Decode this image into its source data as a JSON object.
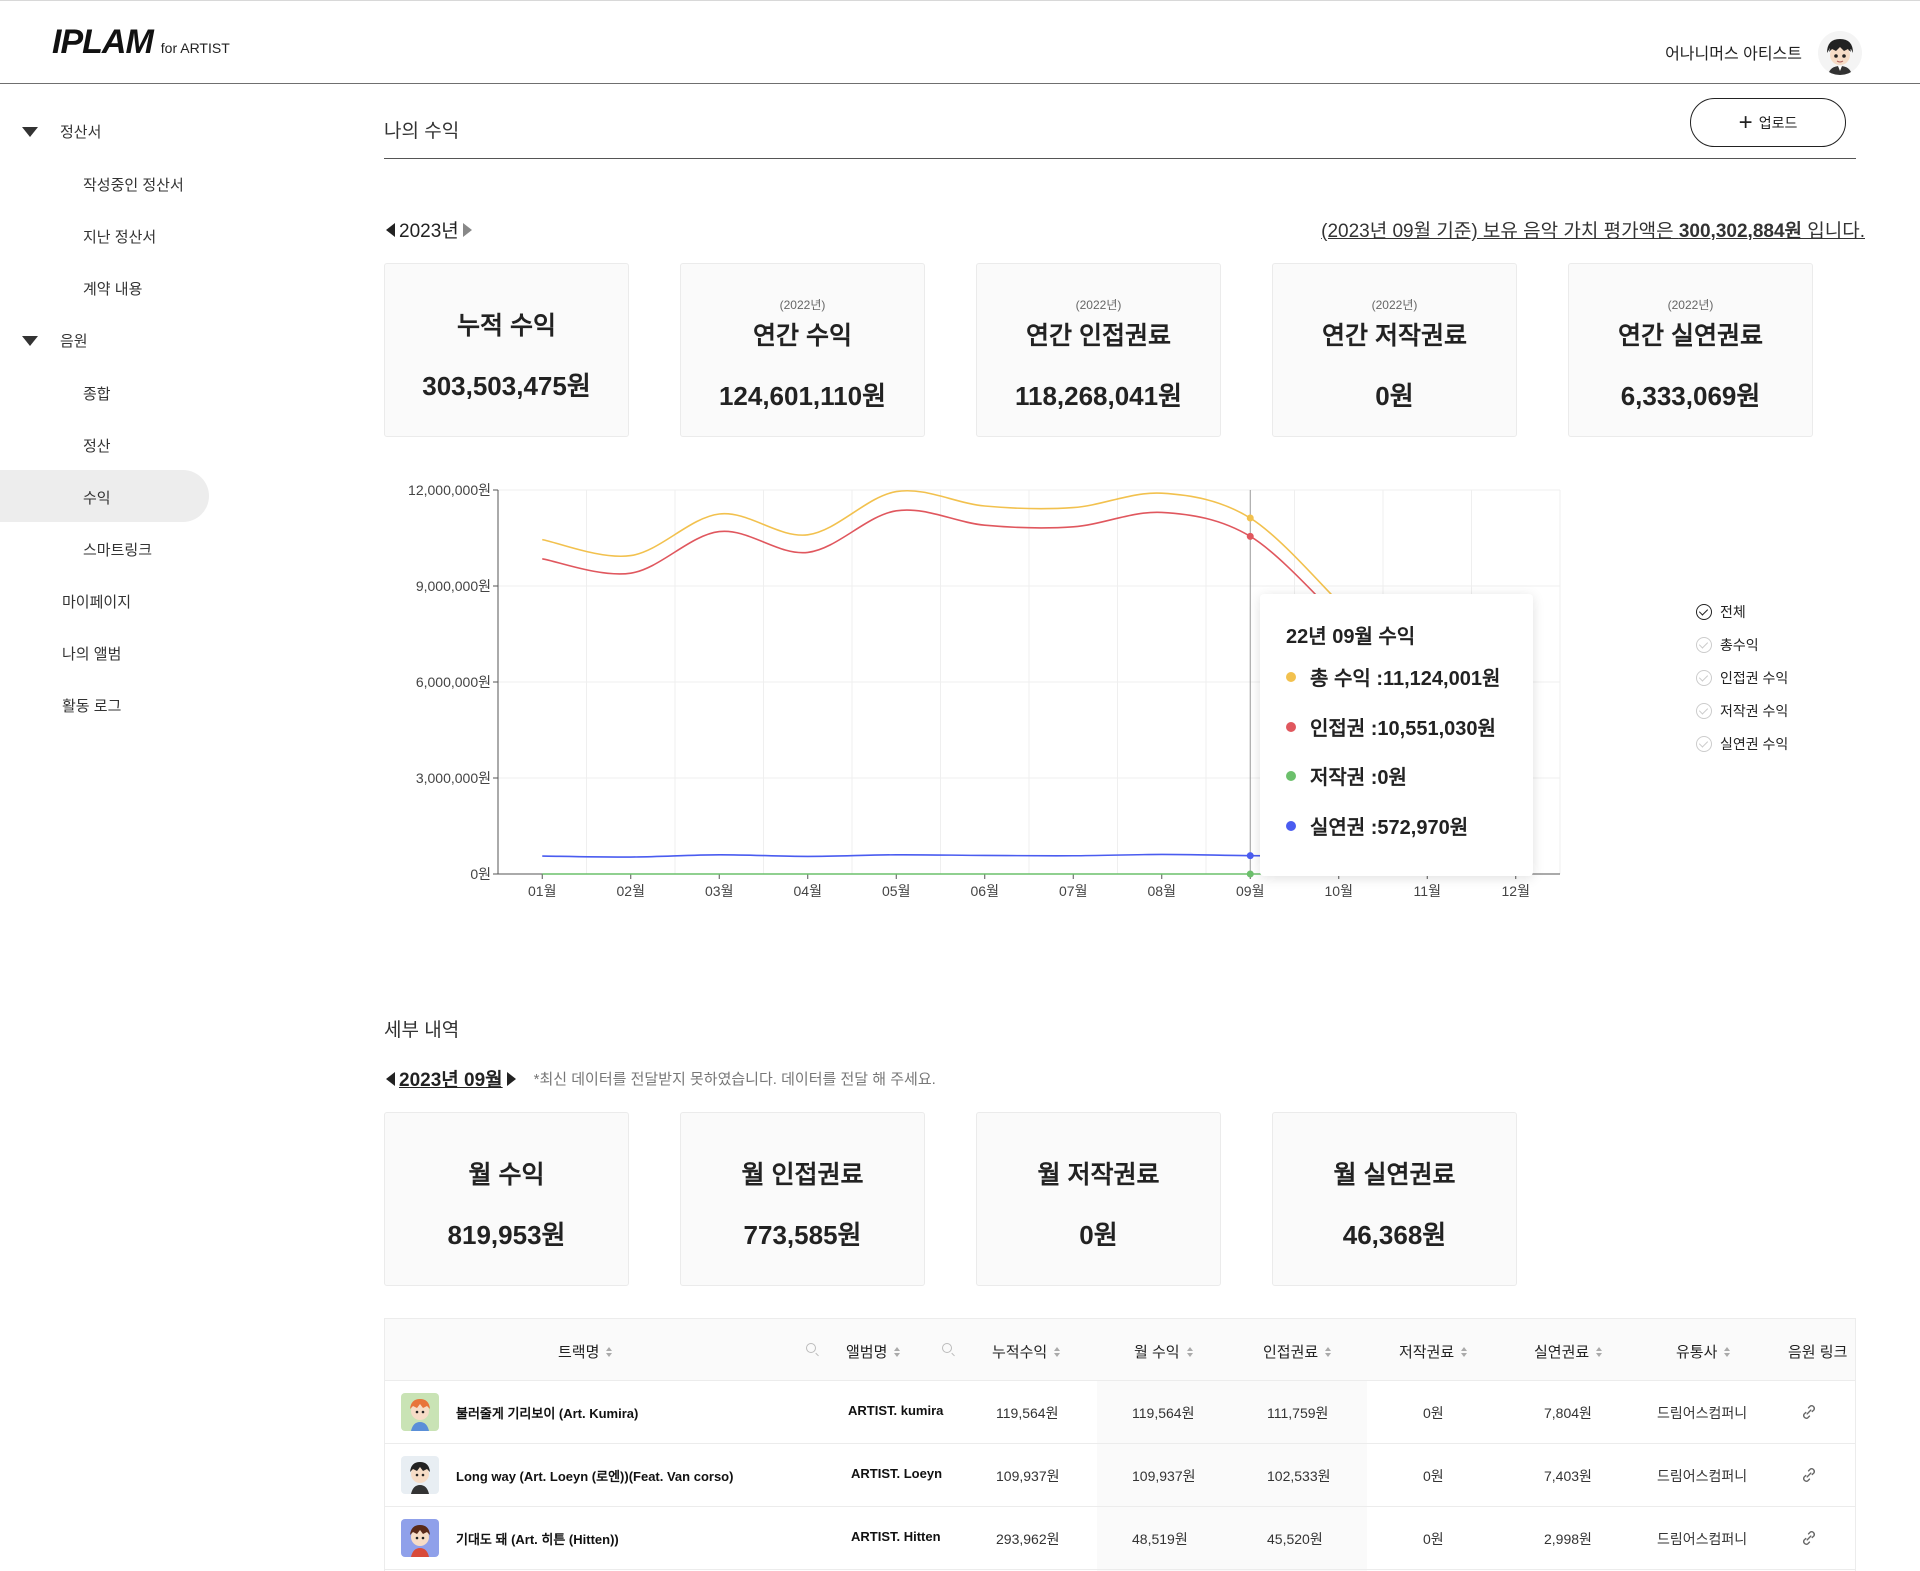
{
  "header": {
    "logo_main": "IPLAM",
    "logo_sub": "for ARTIST",
    "user_name": "어나니머스 아티스트"
  },
  "sidebar": {
    "groups": [
      {
        "label": "정산서",
        "items": [
          "작성중인 정산서",
          "지난 정산서",
          "계약 내용"
        ]
      },
      {
        "label": "음원",
        "items": [
          "종합",
          "정산",
          "수익",
          "스마트링크"
        ]
      }
    ],
    "top_items": [
      "마이페이지",
      "나의 앨범",
      "활동 로그"
    ],
    "active_item": "수익"
  },
  "page": {
    "title": "나의 수익",
    "upload_label": "업로드"
  },
  "year_selector": {
    "year": "2023년"
  },
  "valuation": {
    "prefix": "(2023년 09월 기준) 보유 음악 가치 평가액은 ",
    "amount": "300,302,884원",
    "suffix": " 입니다."
  },
  "annual_cards": [
    {
      "sub": "",
      "label": "누적 수익",
      "value": "303,503,475원"
    },
    {
      "sub": "(2022년)",
      "label": "연간 수익",
      "value": "124,601,110원"
    },
    {
      "sub": "(2022년)",
      "label": "연간 인접권료",
      "value": "118,268,041원"
    },
    {
      "sub": "(2022년)",
      "label": "연간 저작권료",
      "value": "0원"
    },
    {
      "sub": "(2022년)",
      "label": "연간 실연권료",
      "value": "6,333,069원"
    }
  ],
  "chart_data": {
    "type": "line",
    "categories": [
      "01월",
      "02월",
      "03월",
      "04월",
      "05월",
      "06월",
      "07월",
      "08월",
      "09월",
      "10월",
      "11월",
      "12월"
    ],
    "y_ticks": [
      "0원",
      "3,000,000원",
      "6,000,000원",
      "9,000,000원",
      "12,000,000원"
    ],
    "ylim": [
      0,
      12000000
    ],
    "grid": true,
    "legend_position": "right",
    "series": [
      {
        "key": "total",
        "color": "#f2c14e",
        "values": [
          10450000,
          9950000,
          11250000,
          10600000,
          11950000,
          11500000,
          11450000,
          11900000,
          11124001,
          8500000,
          null,
          null
        ]
      },
      {
        "key": "neighbor",
        "color": "#e0575e",
        "values": [
          9850000,
          9400000,
          10700000,
          10050000,
          11350000,
          10900000,
          10850000,
          11300000,
          10551030,
          8000000,
          null,
          null
        ]
      },
      {
        "key": "copyright",
        "color": "#6cc06c",
        "values": [
          0,
          0,
          0,
          0,
          0,
          0,
          0,
          0,
          0,
          0,
          null,
          null
        ]
      },
      {
        "key": "performance",
        "color": "#4a5cf0",
        "values": [
          560000,
          530000,
          600000,
          550000,
          600000,
          580000,
          570000,
          610000,
          572970,
          560000,
          null,
          null
        ]
      }
    ],
    "tooltip": {
      "title": "22년 09월 수익",
      "index": 8,
      "rows": [
        {
          "text": "총 수익 :11,124,001원",
          "color": "#f2c14e"
        },
        {
          "text": "인접권 :10,551,030원",
          "color": "#e0575e"
        },
        {
          "text": "저작권 :0원",
          "color": "#6cc06c"
        },
        {
          "text": "실연권 :572,970원",
          "color": "#4a5cf0"
        }
      ]
    },
    "legend": [
      {
        "label": "전체",
        "checked": true
      },
      {
        "label": "총수익",
        "checked": false
      },
      {
        "label": "인접권 수익",
        "checked": false
      },
      {
        "label": "저작권 수익",
        "checked": false
      },
      {
        "label": "실연권 수익",
        "checked": false
      }
    ]
  },
  "detail": {
    "title": "세부 내역",
    "month": "2023년 09월",
    "note": "*최신 데이터를 전달받지 못하였습니다. 데이터를 전달 해 주세요."
  },
  "monthly_cards": [
    {
      "label": "월 수익",
      "value": "819,953원"
    },
    {
      "label": "월 인접권료",
      "value": "773,585원"
    },
    {
      "label": "월 저작권료",
      "value": "0원"
    },
    {
      "label": "월 실연권료",
      "value": "46,368원"
    }
  ],
  "table": {
    "headers": [
      "트랙명",
      "앨범명",
      "누적수익",
      "월 수익",
      "인접권료",
      "저작권료",
      "실연권료",
      "유통사",
      "음원 링크"
    ],
    "rows": [
      {
        "track": "불러줄게 기리보이 (Art. Kumira)",
        "album": "ARTIST. kumira",
        "total": "119,564원",
        "month": "119,564원",
        "neighbor": "111,759원",
        "copyright": "0원",
        "performance": "7,804원",
        "distributor": "드림어스컴퍼니",
        "thumb_color": "#c9e3b5"
      },
      {
        "track": "Long way (Art. Loeyn (로엔))(Feat. Van corso)",
        "album": "ARTIST. Loeyn",
        "total": "109,937원",
        "month": "109,937원",
        "neighbor": "102,533원",
        "copyright": "0원",
        "performance": "7,403원",
        "distributor": "드림어스컴퍼니",
        "thumb_color": "#e8eef3"
      },
      {
        "track": "기대도 돼 (Art. 히튼 (Hitten))",
        "album": "ARTIST. Hitten",
        "total": "293,962원",
        "month": "48,519원",
        "neighbor": "45,520원",
        "copyright": "0원",
        "performance": "2,998원",
        "distributor": "드림어스컴퍼니",
        "thumb_color": "#8fa0ea"
      }
    ]
  }
}
